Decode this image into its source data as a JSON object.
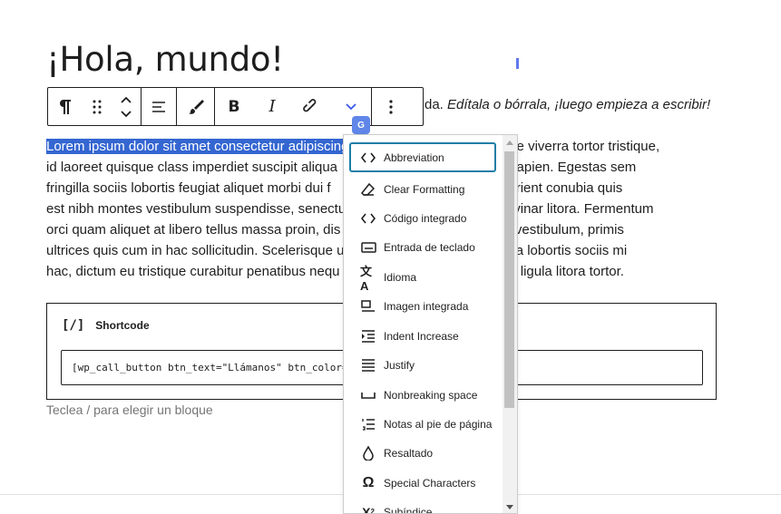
{
  "post": {
    "title": "¡Hola, mundo!",
    "line_tail_plain": "da. ",
    "line_tail_italic": "Edítala o bórrala, ¡luego empieza a escribir!"
  },
  "toolbar": {
    "buttons": [
      "paragraph",
      "drag",
      "move-up-down",
      "align",
      "highlight",
      "bold",
      "italic",
      "link",
      "more-rich-text",
      "options"
    ]
  },
  "paragraph": {
    "lines": [
      {
        "selected": "Lorem ipsum dolor sit amet consectetur adipiscing",
        "rest": "                              celerisque viverra tortor tristique,"
      },
      {
        "selected": "",
        "rest": "id laoreet quisque class imperdiet suscipit aliqua                              ibus arcu sapien. Egestas sem"
      },
      {
        "selected": "",
        "rest": "fringilla sociis lobortis feugiat aliquet morbi dui f                              nim et parturient conubia quis"
      },
      {
        "selected": "",
        "rest": "est nibh montes vestibulum suspendisse, senectu                              c nec pulvinar litora. Fermentum"
      },
      {
        "selected": "",
        "rest": "orci quam aliquet at libero tellus massa proin, dis                              phasellus vestibulum, primis"
      },
      {
        "selected": "",
        "rest": "ultrices quis cum in hac sollicitudin. Scelerisque u                              m pharetra lobortis sociis mi"
      },
      {
        "selected": "",
        "rest": "hac, dictum eu tristique curabitur penatibus nequ                              acerat orci ligula litora tortor."
      }
    ]
  },
  "shortcode": {
    "label": "Shortcode",
    "icon_text": "[/]",
    "value": "[wp_call_button btn_text=\"Llámanos\" btn_color=\""
  },
  "placeholder": "Teclea / para elegir un bloque",
  "badge_text": "G",
  "dropdown": {
    "items": [
      {
        "label": "Abbreviation",
        "icon": "code-icon",
        "focused": true
      },
      {
        "label": "Clear Formatting",
        "icon": "eraser-icon"
      },
      {
        "label": "Código integrado",
        "icon": "code-icon"
      },
      {
        "label": "Entrada de teclado",
        "icon": "keyboard-icon"
      },
      {
        "label": "Idioma",
        "icon": "translate-icon"
      },
      {
        "label": "Imagen integrada",
        "icon": "inline-image-icon"
      },
      {
        "label": "Indent Increase",
        "icon": "indent-icon"
      },
      {
        "label": "Justify",
        "icon": "justify-icon"
      },
      {
        "label": "Nonbreaking space",
        "icon": "space-icon"
      },
      {
        "label": "Notas al pie de página",
        "icon": "footnote-icon"
      },
      {
        "label": "Resaltado",
        "icon": "drop-icon"
      },
      {
        "label": "Special Characters",
        "icon": "omega-icon"
      },
      {
        "label": "Subíndice",
        "icon": "subscript-icon"
      }
    ]
  }
}
